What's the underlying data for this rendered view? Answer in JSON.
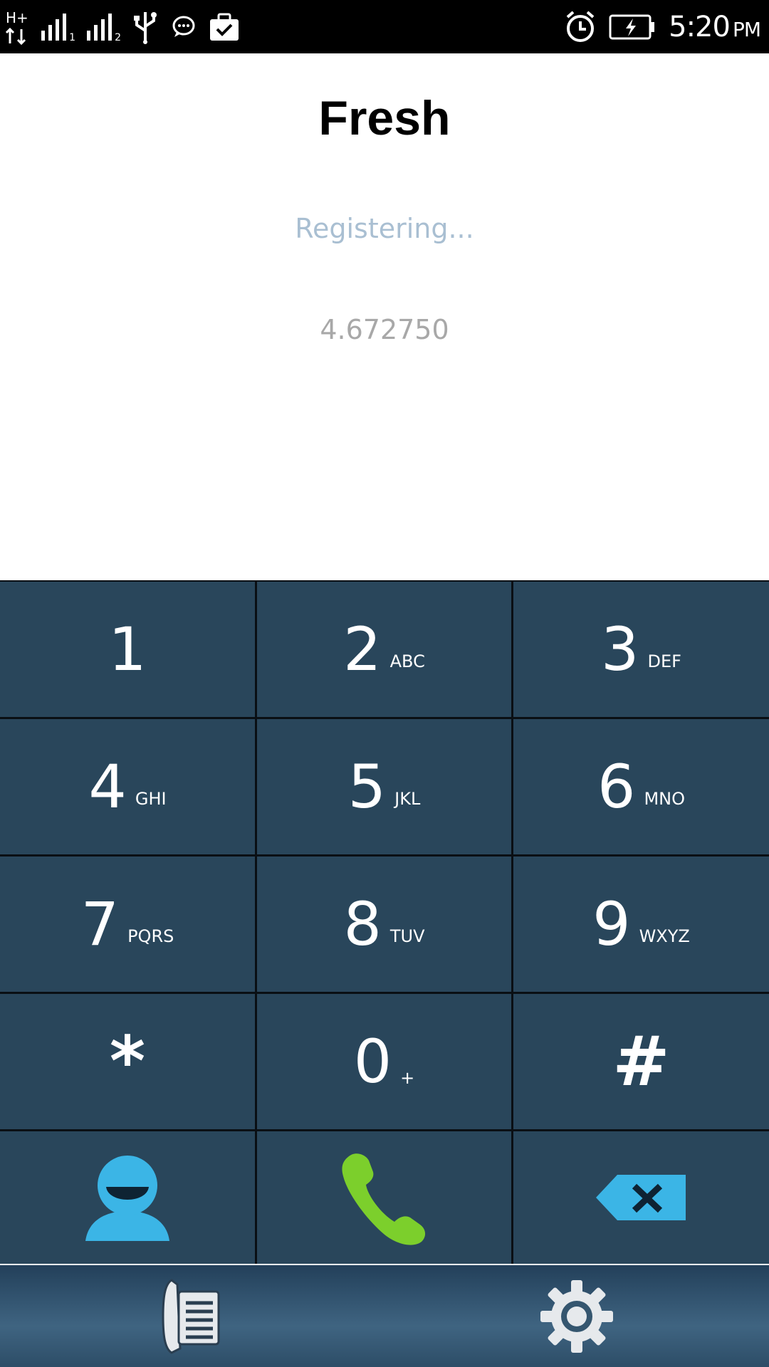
{
  "status_bar": {
    "network": "H+",
    "sim1": "1",
    "sim2": "2",
    "time": "5:20",
    "ampm": "PM",
    "icons": [
      "network-h-plus-icon",
      "signal-sim1-icon",
      "signal-sim2-icon",
      "usb-icon",
      "chat-bubble-icon",
      "briefcase-check-icon",
      "alarm-icon",
      "battery-charging-icon"
    ]
  },
  "app": {
    "title": "Fresh",
    "status": "Registering...",
    "number": "4.672750"
  },
  "keypad": {
    "keys": [
      {
        "digit": "1",
        "letters": ""
      },
      {
        "digit": "2",
        "letters": "ABC"
      },
      {
        "digit": "3",
        "letters": "DEF"
      },
      {
        "digit": "4",
        "letters": "GHI"
      },
      {
        "digit": "5",
        "letters": "JKL"
      },
      {
        "digit": "6",
        "letters": "MNO"
      },
      {
        "digit": "7",
        "letters": "PQRS"
      },
      {
        "digit": "8",
        "letters": "TUV"
      },
      {
        "digit": "9",
        "letters": "WXYZ"
      },
      {
        "digit": "*",
        "letters": ""
      },
      {
        "digit": "0",
        "letters": "+"
      },
      {
        "digit": "#",
        "letters": ""
      }
    ],
    "actions": [
      "contacts-icon",
      "call-icon",
      "backspace-icon"
    ]
  },
  "bottom_bar": {
    "icons": [
      "call-log-icon",
      "settings-gear-icon"
    ]
  },
  "colors": {
    "key_bg": "#29465b",
    "status_text": "#a9bfd2",
    "call_green": "#7ccf2c",
    "accent_blue": "#3bb5e6"
  }
}
